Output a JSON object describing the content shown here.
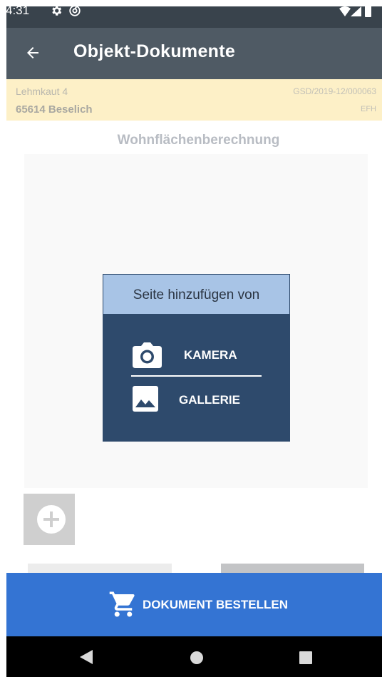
{
  "status_bar": {
    "time": "4:31"
  },
  "app_bar": {
    "title": "Objekt-Dokumente"
  },
  "object": {
    "street": "Lehmkaut 4",
    "city": "65614 Beselich",
    "reference": "GSD/2019-12/000063",
    "type": "EFH"
  },
  "document": {
    "title": "Wohnflächenberechnung"
  },
  "dialog": {
    "title": "Seite hinzufügen von",
    "camera_label": "KAMERA",
    "gallery_label": "GALLERIE"
  },
  "order": {
    "label": "DOKUMENT BESTELLEN"
  },
  "colors": {
    "app_bar": "#4f5a64",
    "header_bg": "#fdf0c7",
    "dialog_bg": "#2e4a6c",
    "dialog_header": "#a8c4e6",
    "accent": "#3474d3"
  }
}
